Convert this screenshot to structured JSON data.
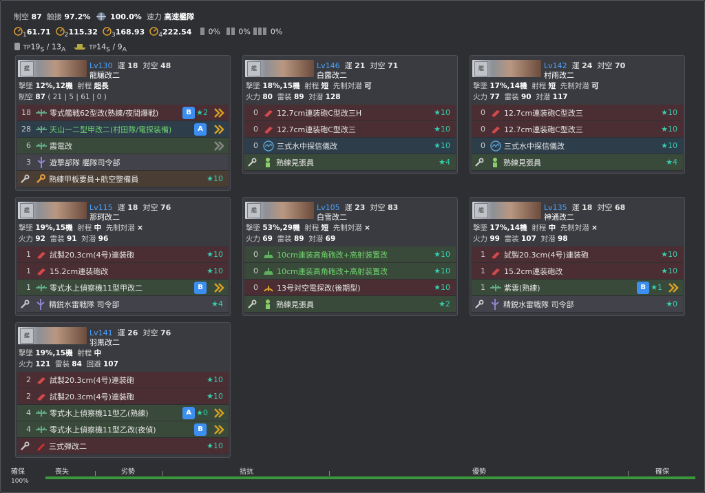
{
  "header": {
    "air_label": "制空",
    "air_value": "87",
    "contact_label": "触接",
    "contact_value": "97.2%",
    "recon_value": "100.0%",
    "speed_label": "速力",
    "speed_value": "高速艦隊",
    "los": [
      {
        "idx": "1",
        "value": "61.71"
      },
      {
        "idx": "2",
        "value": "115.32"
      },
      {
        "idx": "3",
        "value": "168.93"
      },
      {
        "idx": "4",
        "value": "222.54"
      }
    ],
    "supply": [
      "0%",
      "0%",
      "0%"
    ],
    "tp1": "19",
    "tp1_sub": "S",
    "tp1_sep": " / ",
    "tp1b": "13",
    "tp1b_sub": "A",
    "tp_label": "TP",
    "tp2": "14",
    "tp2_sub": "S",
    "tp2b": "9",
    "tp2b_sub": "A"
  },
  "ships": [
    {
      "lv": "Lv130",
      "luck_label": "運",
      "luck": "18",
      "aa_label": "対空",
      "aa": "48",
      "name": "龍驤改二",
      "row1": {
        "a_label": "撃墜",
        "a": "12%,12機",
        "b_label": "射程",
        "b": "超長"
      },
      "row2": {
        "a_label": "制空",
        "a": "87",
        "b": "( 21 | 5 | 61 | 0 )"
      },
      "equips": [
        {
          "cnt": "18",
          "name": "零式艦戦62型改(熟練/夜間爆戦)",
          "badge": "B",
          "star": "2",
          "prof": true,
          "color": "red"
        },
        {
          "cnt": "28",
          "name": "天山一二型甲改二(村田隊/電探装備)",
          "badge": "A",
          "star": "",
          "prof": true,
          "color": "blu",
          "ok": true
        },
        {
          "cnt": "6",
          "name": "震電改",
          "badge": "",
          "star": "",
          "prof": true,
          "color": "grn"
        },
        {
          "cnt": "3",
          "name": "遊撃部隊 艦隊司令部",
          "badge": "",
          "star": "",
          "prof": false,
          "color": "gry"
        },
        {
          "cnt": "",
          "name": "熟練甲板要員+航空整備員",
          "badge": "",
          "star": "10",
          "prof": false,
          "color": "brn"
        }
      ]
    },
    {
      "lv": "Lv146",
      "luck_label": "運",
      "luck": "21",
      "aa_label": "対空",
      "aa": "71",
      "name": "白露改二",
      "row1": {
        "a_label": "撃墜",
        "a": "18%,15機",
        "b_label": "射程",
        "b": "短",
        "c_label": "先制対潜",
        "c": "可"
      },
      "row2": {
        "fp_label": "火力",
        "fp": "80",
        "tp_label": "雷装",
        "tp": "89",
        "as_label": "対潜",
        "as": "128"
      },
      "equips": [
        {
          "cnt": "0",
          "name": "12.7cm連装砲C型改三H",
          "badge": "",
          "star": "10",
          "prof": false,
          "color": "red"
        },
        {
          "cnt": "0",
          "name": "12.7cm連装砲C型改三",
          "badge": "",
          "star": "10",
          "prof": false,
          "color": "red"
        },
        {
          "cnt": "0",
          "name": "三式水中探信儀改",
          "badge": "",
          "star": "10",
          "prof": false,
          "color": "blu"
        },
        {
          "cnt": "",
          "name": "熟練見張員",
          "badge": "",
          "star": "4",
          "prof": false,
          "color": "grn"
        }
      ]
    },
    {
      "lv": "Lv142",
      "luck_label": "運",
      "luck": "24",
      "aa_label": "対空",
      "aa": "70",
      "name": "村雨改二",
      "row1": {
        "a_label": "撃墜",
        "a": "17%,14機",
        "b_label": "射程",
        "b": "短",
        "c_label": "先制対潜",
        "c": "可"
      },
      "row2": {
        "fp_label": "火力",
        "fp": "77",
        "tp_label": "雷装",
        "tp": "90",
        "as_label": "対潜",
        "as": "117"
      },
      "equips": [
        {
          "cnt": "0",
          "name": "12.7cm連装砲C型改三",
          "badge": "",
          "star": "10",
          "prof": false,
          "color": "red"
        },
        {
          "cnt": "0",
          "name": "12.7cm連装砲C型改三",
          "badge": "",
          "star": "10",
          "prof": false,
          "color": "red"
        },
        {
          "cnt": "0",
          "name": "三式水中探信儀改",
          "badge": "",
          "star": "10",
          "prof": false,
          "color": "blu"
        },
        {
          "cnt": "",
          "name": "熟練見張員",
          "badge": "",
          "star": "4",
          "prof": false,
          "color": "grn"
        }
      ]
    },
    {
      "lv": "Lv115",
      "luck_label": "運",
      "luck": "18",
      "aa_label": "対空",
      "aa": "76",
      "name": "那珂改二",
      "row1": {
        "a_label": "撃墜",
        "a": "19%,15機",
        "b_label": "射程",
        "b": "中",
        "c_label": "先制対潜",
        "c": "×"
      },
      "row2": {
        "fp_label": "火力",
        "fp": "92",
        "tp_label": "雷装",
        "tp": "91",
        "as_label": "対潜",
        "as": "96"
      },
      "equips": [
        {
          "cnt": "1",
          "name": "試製20.3cm(4号)連装砲",
          "badge": "",
          "star": "10",
          "prof": false,
          "color": "red"
        },
        {
          "cnt": "1",
          "name": "15.2cm連装砲改",
          "badge": "",
          "star": "10",
          "prof": false,
          "color": "red"
        },
        {
          "cnt": "1",
          "name": "零式水上偵察機11型甲改二",
          "badge": "B",
          "star": "",
          "prof": true,
          "color": "grn"
        },
        {
          "cnt": "",
          "name": "精鋭水雷戦隊 司令部",
          "badge": "",
          "star": "4",
          "prof": false,
          "color": "gry"
        }
      ]
    },
    {
      "lv": "Lv105",
      "luck_label": "運",
      "luck": "23",
      "aa_label": "対空",
      "aa": "83",
      "name": "白雪改二",
      "row1": {
        "a_label": "撃墜",
        "a": "53%,29機",
        "b_label": "射程",
        "b": "短",
        "c_label": "先制対潜",
        "c": "×"
      },
      "row2": {
        "fp_label": "火力",
        "fp": "69",
        "tp_label": "雷装",
        "tp": "89",
        "as_label": "対潜",
        "as": "69"
      },
      "equips": [
        {
          "cnt": "0",
          "name": "10cm連装高角砲改+高射装置改",
          "badge": "",
          "star": "10",
          "prof": false,
          "color": "grn",
          "ok": true
        },
        {
          "cnt": "0",
          "name": "10cm連装高角砲改+高射装置改",
          "badge": "",
          "star": "10",
          "prof": false,
          "color": "grn",
          "ok": true
        },
        {
          "cnt": "0",
          "name": "13号対空電探改(後期型)",
          "badge": "",
          "star": "10",
          "prof": false,
          "color": "red"
        },
        {
          "cnt": "",
          "name": "熟練見張員",
          "badge": "",
          "star": "2",
          "prof": false,
          "color": "grn"
        }
      ]
    },
    {
      "lv": "Lv135",
      "luck_label": "運",
      "luck": "18",
      "aa_label": "対空",
      "aa": "68",
      "name": "神通改二",
      "row1": {
        "a_label": "撃墜",
        "a": "17%,14機",
        "b_label": "射程",
        "b": "中",
        "c_label": "先制対潜",
        "c": "×"
      },
      "row2": {
        "fp_label": "火力",
        "fp": "99",
        "tp_label": "雷装",
        "tp": "107",
        "as_label": "対潜",
        "as": "98"
      },
      "equips": [
        {
          "cnt": "1",
          "name": "試製20.3cm(4号)連装砲",
          "badge": "",
          "star": "10",
          "prof": false,
          "color": "red"
        },
        {
          "cnt": "1",
          "name": "15.2cm連装砲改",
          "badge": "",
          "star": "10",
          "prof": false,
          "color": "red"
        },
        {
          "cnt": "1",
          "name": "紫雲(熟練)",
          "badge": "B",
          "star": "1",
          "prof": true,
          "color": "grn"
        },
        {
          "cnt": "",
          "name": "精鋭水雷戦隊 司令部",
          "badge": "",
          "star": "0",
          "prof": false,
          "color": "gry"
        }
      ]
    },
    {
      "lv": "Lv141",
      "luck_label": "運",
      "luck": "26",
      "aa_label": "対空",
      "aa": "76",
      "name": "羽黒改二",
      "row1": {
        "a_label": "撃墜",
        "a": "19%,15機",
        "b_label": "射程",
        "b": "中"
      },
      "row2": {
        "fp_label": "火力",
        "fp": "121",
        "tp_label": "雷装",
        "tp": "84",
        "as_label": "回避",
        "as": "107"
      },
      "equips": [
        {
          "cnt": "2",
          "name": "試製20.3cm(4号)連装砲",
          "badge": "",
          "star": "10",
          "prof": false,
          "color": "red"
        },
        {
          "cnt": "2",
          "name": "試製20.3cm(4号)連装砲",
          "badge": "",
          "star": "10",
          "prof": false,
          "color": "red"
        },
        {
          "cnt": "4",
          "name": "零式水上偵察機11型乙(熟練)",
          "badge": "A",
          "star": "0",
          "prof": true,
          "color": "grn"
        },
        {
          "cnt": "4",
          "name": "零式水上偵察機11型乙改(夜偵)",
          "badge": "B",
          "star": "",
          "prof": true,
          "color": "grn"
        },
        {
          "cnt": "",
          "name": "三式弾改二",
          "badge": "",
          "star": "10",
          "prof": false,
          "color": "red"
        }
      ]
    }
  ],
  "scale": {
    "left_label": "確保",
    "left_pct": "100%",
    "labels": [
      "喪失",
      "劣勢",
      "拮抗",
      "優勢",
      "確保"
    ],
    "fill_fraction": 1.0
  }
}
